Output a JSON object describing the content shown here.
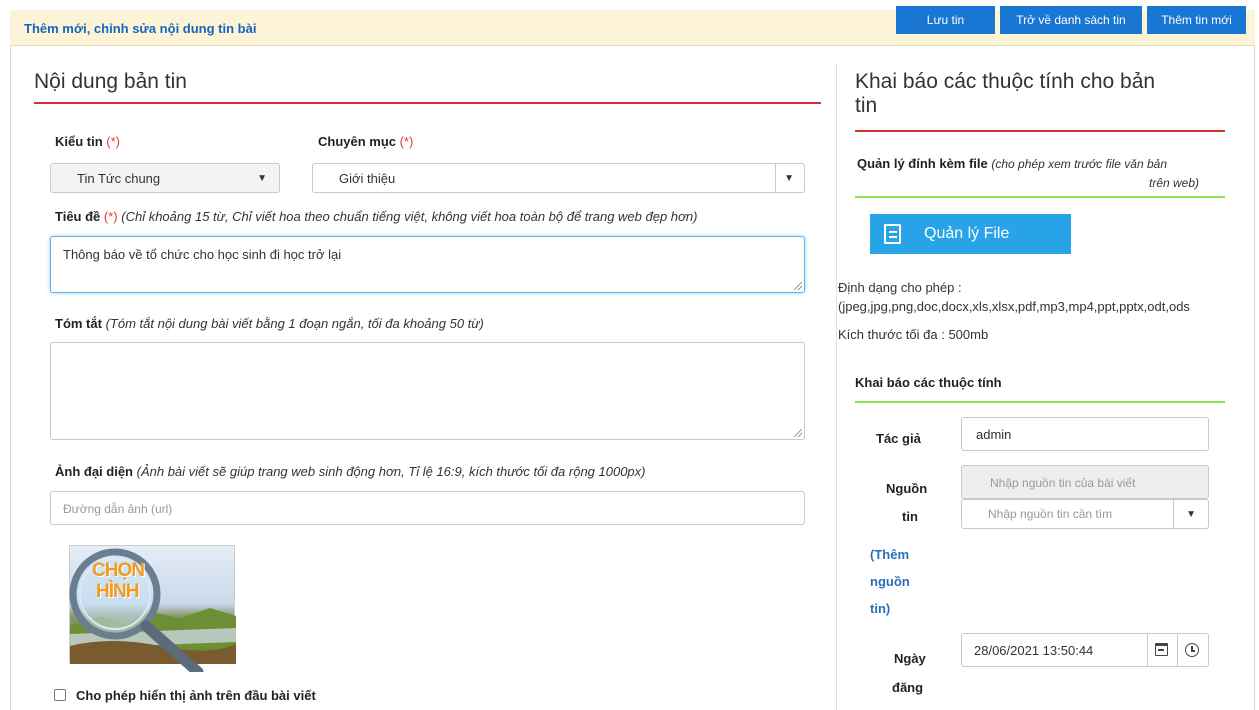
{
  "header": {
    "title": "Thêm mới, chỉnh sửa nội dung tin bài",
    "save_label": "Lưu tin",
    "back_label": "Trở về danh sách tin",
    "new_label": "Thêm tin mới"
  },
  "left": {
    "section_title": "Nội dung bản tin",
    "type_label": "Kiểu tin",
    "required_mark": "(*)",
    "type_value": "Tin Tức chung",
    "category_label": "Chuyên mục",
    "category_value": "Giới thiệu",
    "title_label": "Tiêu đề",
    "title_hint": "(Chỉ khoảng 15 từ, Chỉ viết hoa theo chuẩn tiếng việt, không viết hoa toàn bộ để trang web đẹp hơn)",
    "title_value": "Thông báo về tổ chức cho học sinh đi học trở lại",
    "summary_label": "Tóm tắt",
    "summary_hint": "(Tóm tắt nội dung bài viết bằng 1 đoạn ngắn, tối đa khoảng 50 từ)",
    "summary_value": "",
    "image_label": "Ảnh đại diện",
    "image_hint": "(Ảnh bài viết sẽ giúp trang web sinh động hơn, Tỉ lệ 16:9, kích thước tối đa rộng 1000px)",
    "image_placeholder": "Đường dẫn ảnh (url)",
    "choose_image_line1": "CHỌN",
    "choose_image_line2": "HÌNH",
    "show_image_label": "Cho phép hiển thị ảnh trên đầu bài viết"
  },
  "right": {
    "section_title_line1": "Khai báo các thuộc tính cho bản",
    "section_title_line2": "tin",
    "attach_label": "Quản lý đính kèm file",
    "attach_hint_line1": "(cho phép xem trước file văn bản",
    "attach_hint_line2": "trên web)",
    "file_button": "Quản lý File",
    "formats_label": "Định dạng cho phép :",
    "formats_value": "(jpeg,jpg,png,doc,docx,xls,xlsx,pdf,mp3,mp4,ppt,pptx,odt,ods",
    "max_size": "Kích thước tối đa : 500mb",
    "props_title": "Khai báo các thuộc tính",
    "author_label": "Tác giả",
    "author_value": "admin",
    "source_label_1": "Nguồn",
    "source_label_2": "tin",
    "source_placeholder": "Nhập nguồn tin của bài viết",
    "source_search_placeholder": "Nhập nguồn tin cần tìm",
    "add_source_1": "(Thêm",
    "add_source_2": "nguồn",
    "add_source_3": "tin)",
    "date_label_1": "Ngày",
    "date_label_2": "đăng",
    "date_value": "28/06/2021 13:50:44"
  },
  "colors": {
    "primary": "#1976d2",
    "accent_red": "#d32f2f",
    "accent_green": "#8ee04e",
    "header_bg": "#fdf3d6",
    "file_button": "#29a3e8"
  }
}
